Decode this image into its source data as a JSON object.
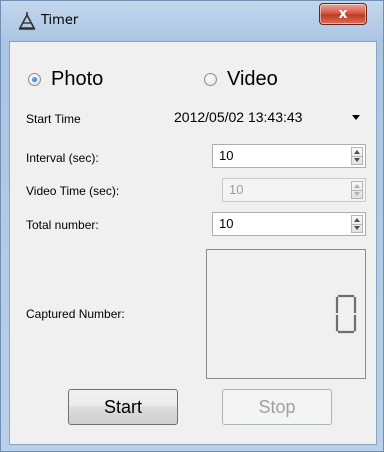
{
  "window": {
    "title": "Timer",
    "close_label": "x"
  },
  "mode": {
    "photo_label": "Photo",
    "video_label": "Video",
    "selected": "Photo"
  },
  "fields": {
    "start_time_label": "Start Time",
    "start_time_value": "2012/05/02 13:43:43",
    "interval_label": "Interval (sec):",
    "interval_value": "10",
    "video_time_label": "Video Time (sec):",
    "video_time_value": "10",
    "total_number_label": "Total number:",
    "total_number_value": "10",
    "captured_label": "Captured Number:",
    "captured_value": "0"
  },
  "buttons": {
    "start_label": "Start",
    "stop_label": "Stop"
  },
  "colors": {
    "close_button": "#c9432b",
    "digit_segment": "#6e6e6e"
  }
}
